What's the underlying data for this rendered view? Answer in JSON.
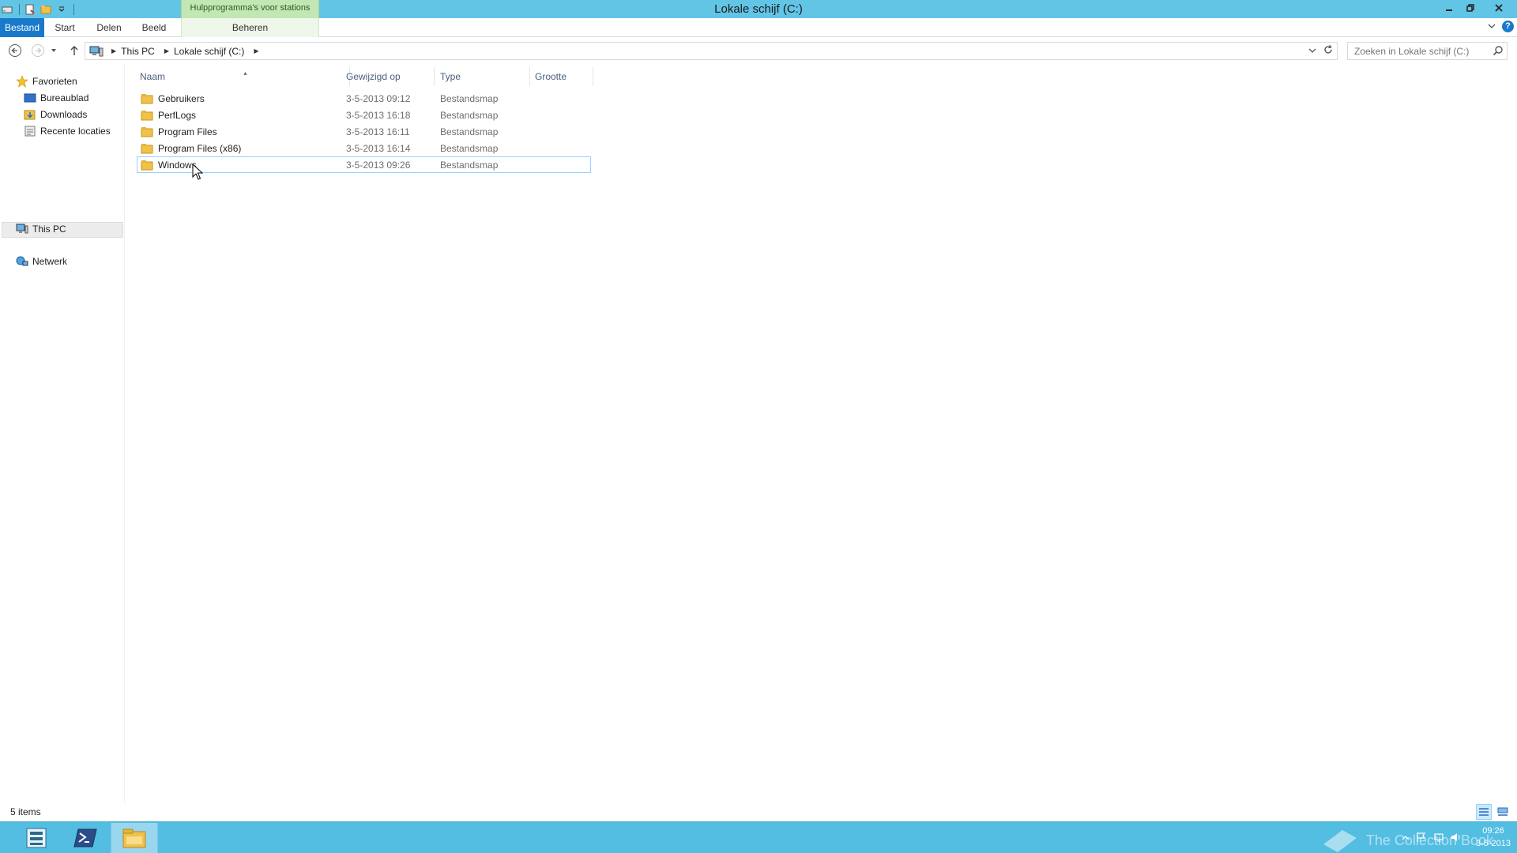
{
  "window": {
    "title": "Lokale schijf (C:)",
    "context_tab_group": "Hulpprogramma's voor stations"
  },
  "ribbon": {
    "tabs": [
      {
        "label": "Bestand"
      },
      {
        "label": "Start"
      },
      {
        "label": "Delen"
      },
      {
        "label": "Beeld"
      },
      {
        "label": "Beheren"
      }
    ]
  },
  "address": {
    "crumbs": [
      "This PC",
      "Lokale schijf (C:)"
    ]
  },
  "search": {
    "placeholder": "Zoeken in Lokale schijf (C:)"
  },
  "navpane": {
    "favorites": {
      "label": "Favorieten",
      "items": [
        {
          "label": "Bureaublad"
        },
        {
          "label": "Downloads"
        },
        {
          "label": "Recente locaties"
        }
      ]
    },
    "this_pc": {
      "label": "This PC"
    },
    "network": {
      "label": "Netwerk"
    }
  },
  "filelist": {
    "columns": [
      {
        "label": "Naam"
      },
      {
        "label": "Gewijzigd op"
      },
      {
        "label": "Type"
      },
      {
        "label": "Grootte"
      }
    ],
    "rows": [
      {
        "name": "Gebruikers",
        "modified": "3-5-2013 09:12",
        "type": "Bestandsmap"
      },
      {
        "name": "PerfLogs",
        "modified": "3-5-2013 16:18",
        "type": "Bestandsmap"
      },
      {
        "name": "Program Files",
        "modified": "3-5-2013 16:11",
        "type": "Bestandsmap"
      },
      {
        "name": "Program Files (x86)",
        "modified": "3-5-2013 16:14",
        "type": "Bestandsmap"
      },
      {
        "name": "Windows",
        "modified": "3-5-2013 09:26",
        "type": "Bestandsmap"
      }
    ]
  },
  "status": {
    "item_count": "5 items"
  },
  "taskbar": {
    "time": "09:26",
    "date": "3-5-2013",
    "watermark": "The Collection Book"
  },
  "colors": {
    "titlebar": "#62c5e6",
    "file_tab": "#1979ca",
    "context_tab": "#c2e6b4",
    "taskbar": "#53bde2",
    "folder": "#f0c24b",
    "selection_border": "#99d1ff"
  }
}
